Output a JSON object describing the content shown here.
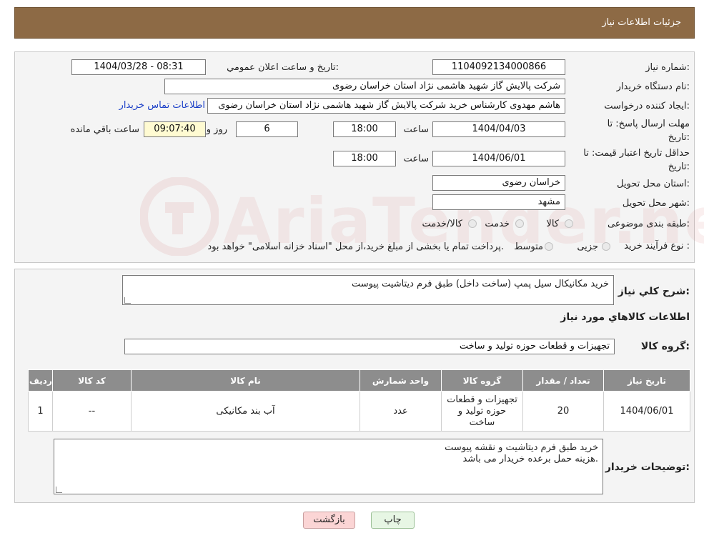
{
  "header": {
    "title": "جزئیات اطلاعات نیاز"
  },
  "watermark": {
    "text": "AriaTender.neT"
  },
  "fields": {
    "need_number_label": "شماره نیاز:",
    "need_number": "1104092134000866",
    "announce_label": "تاریخ و ساعت اعلان عمومي:",
    "announce_value": "1404/03/28 - 08:31",
    "buyer_org_label": "نام دستگاه خریدار:",
    "buyer_org": "شرکت پالایش گاز شهید هاشمی نژاد   استان خراسان رضوی",
    "requester_label": "ایجاد کننده درخواست:",
    "requester": "هاشم مهدوی کارشناس خرید شرکت پالایش گاز شهید هاشمی نژاد   استان خراسان رضوی",
    "contact_link": "اطلاعات تماس خریدار",
    "deadline_label_1": "مهلت ارسال پاسخ: تا",
    "deadline_label_2": "تاریخ:",
    "deadline_date": "1404/04/03",
    "time_label": "ساعت",
    "deadline_time": "18:00",
    "days_value": "6",
    "days_label": "روز و",
    "remaining_time": "09:07:40",
    "remaining_label": "ساعت باقي مانده",
    "validity_label_1": "حداقل تاریخ اعتبار قیمت: تا",
    "validity_label_2": "تاریخ:",
    "validity_date": "1404/06/01",
    "validity_time": "18:00",
    "province_label": "استان محل تحویل:",
    "province": "خراسان رضوی",
    "city_label": "شهر محل تحویل:",
    "city": "مشهد",
    "category_label": "طبقه بندی موضوعی:",
    "category_options": [
      "کالا",
      "خدمت",
      "کالا/خدمت"
    ],
    "process_label": "نوع فرآیند خرید :",
    "process_options": [
      "جزیی",
      "متوسط"
    ],
    "process_note": "پرداخت تمام یا بخشی از مبلغ خرید،از محل \"اسناد خزانه اسلامی\" خواهد بود."
  },
  "summary": {
    "desc_label": "شرح کلي نیاز:",
    "desc_value": "خرید مکانیکال سیل پمپ (ساخت داخل) طبق فرم دیتاشیت پیوست",
    "items_title": "اطلاعات کالاهاي مورد نیاز",
    "group_label": "گروه کالا:",
    "group_value": "تجهیزات و قطعات حوزه تولید و ساخت"
  },
  "table": {
    "headers": [
      "ردیف",
      "کد کالا",
      "نام کالا",
      "واحد شمارش",
      "گروه کالا",
      "تعداد / مقدار",
      "تاریخ نیاز"
    ],
    "rows": [
      [
        "1",
        "--",
        "آب بند مکانیکی",
        "عدد",
        "تجهیزات و قطعات حوزه تولید و ساخت",
        "20",
        "1404/06/01"
      ]
    ]
  },
  "notes": {
    "label": "توضیحات خریدار:",
    "line1": "خرید طبق فرم دیتاشیت و نقشه پیوست",
    "line2": "هزینه حمل برعده خریدار می باشد."
  },
  "buttons": {
    "print": "چاپ",
    "back": "بازگشت"
  }
}
